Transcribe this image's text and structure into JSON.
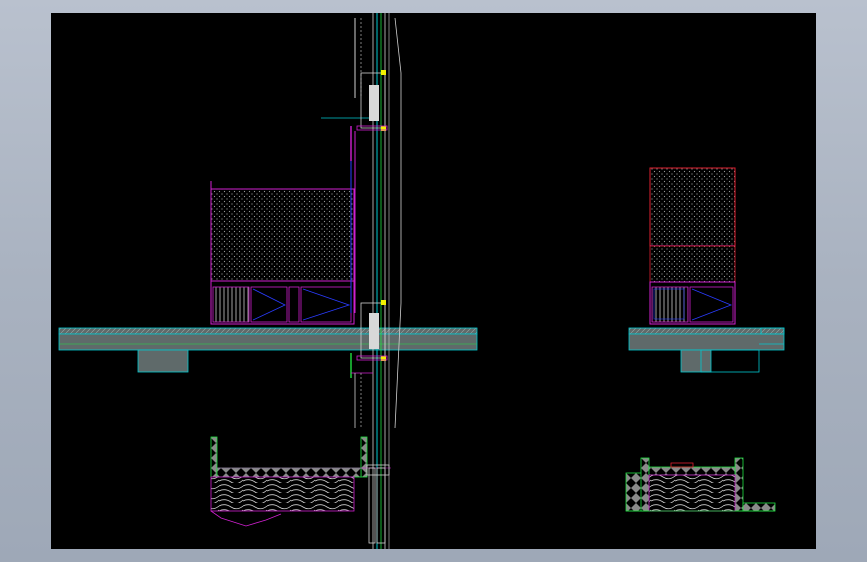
{
  "drawing": {
    "background": "#000000",
    "frame_background": "#aab3c1",
    "colors": {
      "magenta": "#d020d0",
      "cyan": "#00c8d0",
      "blue": "#2a3cff",
      "green": "#20e040",
      "yellow": "#f0f000",
      "red": "#e02030",
      "white": "#e8e8e8",
      "concrete": "#707070",
      "slab_fill": "#5f6a6a",
      "hatch": "#c8c8c8"
    },
    "icons": {
      "pattern_dots": "crosshatch-pattern",
      "pattern_lines": "vertical-slat-pattern",
      "pattern_wood": "wood-grain-pattern",
      "pattern_checker": "checker-pattern"
    }
  }
}
